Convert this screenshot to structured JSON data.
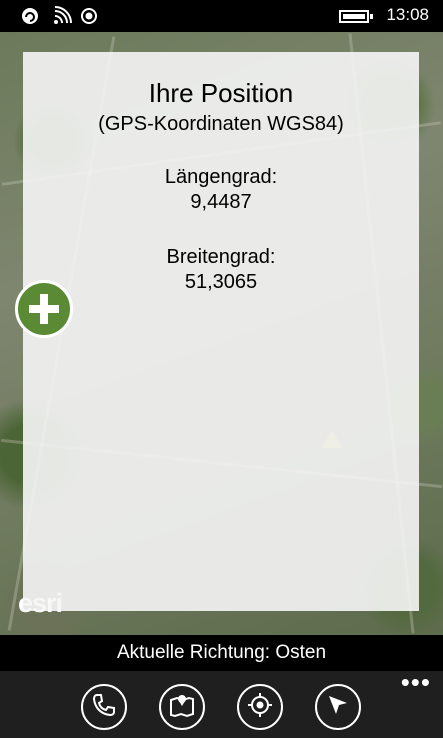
{
  "status_bar": {
    "time": "13:08"
  },
  "map": {
    "attribution": "esri"
  },
  "panel": {
    "title": "Ihre Position",
    "subtitle": "(GPS-Koordinaten WGS84)",
    "longitude_label": "Längengrad:",
    "longitude_value": "9,4487",
    "latitude_label": "Breitengrad:",
    "latitude_value": "51,3065"
  },
  "heading_bar": {
    "text": "Aktuelle Richtung: Osten"
  },
  "app_bar": {
    "buttons": [
      {
        "icon": "phone-icon"
      },
      {
        "icon": "map-icon"
      },
      {
        "icon": "location-target-icon"
      },
      {
        "icon": "compass-navigation-icon"
      }
    ],
    "more": "•••"
  },
  "colors": {
    "zoom_button": "#5b8a35",
    "app_bar": "#1f1f1f"
  }
}
